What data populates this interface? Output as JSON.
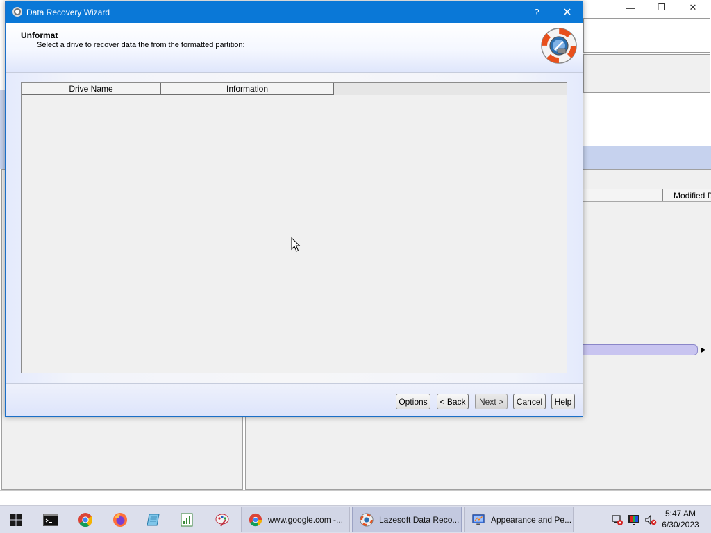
{
  "dialog": {
    "title": "Data Recovery Wizard",
    "help_glyph": "?",
    "close_glyph": "✕",
    "header": {
      "title": "Unformat",
      "subtitle": "Select a drive to recover data the from the formatted partition:"
    },
    "drive_list": {
      "columns": [
        "Drive Name",
        "Information"
      ],
      "rows": []
    },
    "buttons": {
      "options": "Options",
      "back": "< Back",
      "next": "Next >",
      "cancel": "Cancel",
      "help": "Help"
    }
  },
  "background_window": {
    "column_modified": "Modified D",
    "minimize_glyph": "—",
    "restore_glyph": "❐",
    "close_glyph": "✕"
  },
  "taskbar": {
    "pinned": [
      "windows-start-icon",
      "terminal-icon",
      "chrome-icon",
      "firefox-icon",
      "notepad-icon",
      "spreadsheet-icon",
      "paint-icon"
    ],
    "tasks": [
      {
        "label": "www.google.com -...",
        "icon": "chrome-icon"
      },
      {
        "label": "Lazesoft Data Reco...",
        "icon": "lazesoft-icon",
        "active": true
      },
      {
        "label": "Appearance and Pe...",
        "icon": "control-panel-icon"
      }
    ],
    "clock": {
      "time": "5:47 AM",
      "date": "6/30/2023"
    }
  },
  "colors": {
    "dialog_title_bar": "#0a78d7",
    "taskbar": "#dcdfec"
  }
}
